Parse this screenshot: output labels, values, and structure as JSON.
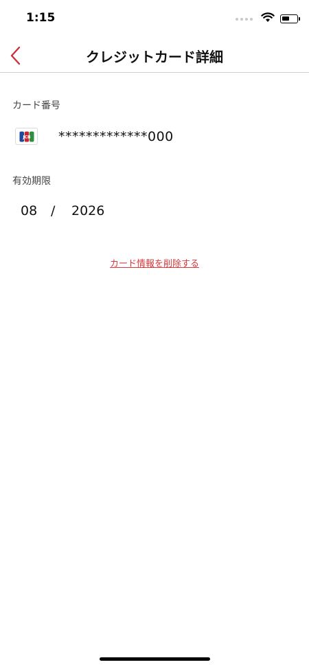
{
  "status_bar": {
    "time": "1:15"
  },
  "header": {
    "title": "クレジットカード詳細",
    "accent_color": "#c8303a"
  },
  "card_number": {
    "label": "カード番号",
    "brand_icon": "jcb-logo-icon",
    "brand_text": "JCB",
    "masked_number": "*************000"
  },
  "expiry": {
    "label": "有効期限",
    "month": "08",
    "separator": "/",
    "year": "2026"
  },
  "actions": {
    "delete_label": "カード情報を削除する",
    "delete_color": "#d9393a"
  }
}
